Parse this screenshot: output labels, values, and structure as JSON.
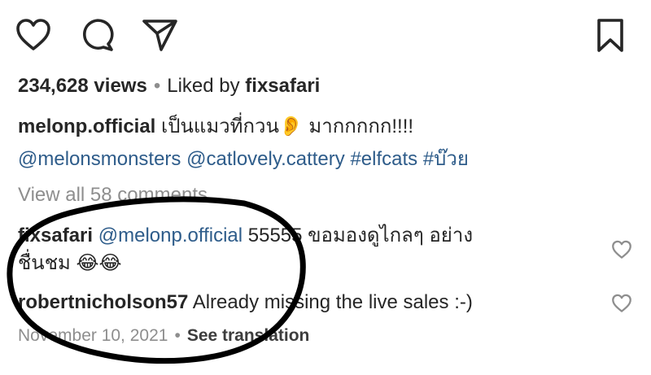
{
  "actions": {
    "like_icon": "heart-outline",
    "comment_icon": "speech-bubble",
    "share_icon": "paper-plane",
    "save_icon": "bookmark-outline"
  },
  "stats": {
    "views": "234,628 views",
    "separator": "•",
    "liked_by_prefix": "Liked by ",
    "liked_by_user": "fixsafari"
  },
  "caption": {
    "username": "melonp.official",
    "text_before_emoji": "เป็นแมวที่กวน",
    "emoji": "👂",
    "text_after_emoji": " มากกกกก!!!!",
    "tags": [
      "@melonsmonsters",
      "@catlovely.cattery",
      "#elfcats",
      "#บ๊วย"
    ]
  },
  "view_all": "View all 58 comments",
  "comments": [
    {
      "username": "fixsafari",
      "mention": "@melonp.official",
      "text_line1": " 55555 ขอมองดูไกลๆ อย่าง",
      "text_line2": "ชื่นชม ",
      "emoji": "😂😂"
    },
    {
      "username": "robertnicholson57",
      "text_line1": " Already missing the live sales :-)"
    }
  ],
  "footer": {
    "date": "November 10, 2021",
    "separator": "•",
    "see_translation": "See translation"
  },
  "colors": {
    "text": "#262626",
    "link": "#2e5c8a",
    "muted": "#8e8e8e",
    "annotation": "#000000"
  }
}
